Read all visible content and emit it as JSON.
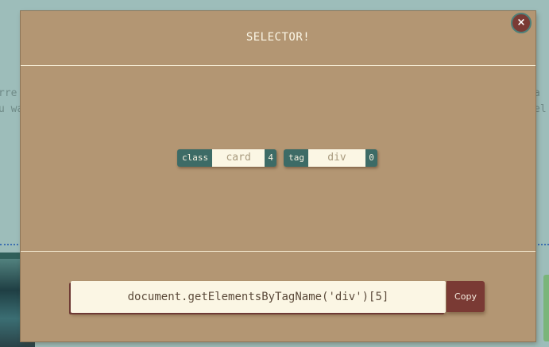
{
  "background": {
    "left_fragment": "rre\nu wa",
    "right_fragment": "a\nel"
  },
  "modal": {
    "title": "SELECTOR!",
    "close_label": "×",
    "selectors": {
      "class": {
        "label": "class",
        "value": "card",
        "count": "4"
      },
      "tag": {
        "label": "tag",
        "value": "div",
        "count": "0"
      }
    },
    "code": "document.getElementsByTagName('div')[5]",
    "copy_label": "Copy"
  },
  "colors": {
    "modal_bg": "#b39673",
    "accent_teal": "#3d6b66",
    "accent_maroon": "#7a3a34",
    "page_bg": "#9dbdba"
  }
}
